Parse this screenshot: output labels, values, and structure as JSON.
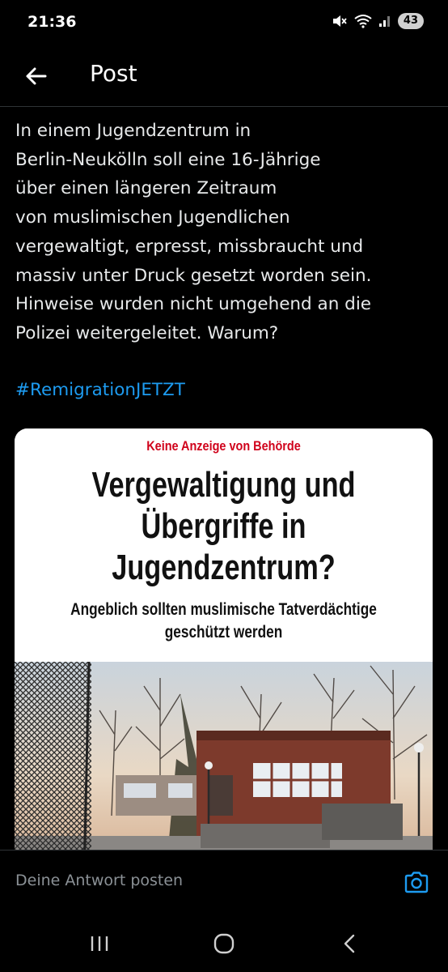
{
  "status_bar": {
    "time": "21:36",
    "battery": "43",
    "icons": [
      "mute-icon",
      "wifi-icon",
      "signal-icon"
    ]
  },
  "header": {
    "title": "Post",
    "back_icon": "arrow-left-icon"
  },
  "post": {
    "text": "In einem Jugendzentrum in\nBerlin-Neukölln soll eine 16-Jährige\nüber einen längeren Zeitraum\nvon muslimischen Jugendlichen\nvergewaltigt, erpresst, missbraucht und\nmassiv unter Druck gesetzt worden sein.\nHinweise wurden nicht umgehend an die\nPolizei weitergeleitet. Warum?",
    "hashtag": "#RemigrationJETZT"
  },
  "article": {
    "kicker": "Keine Anzeige von Behörde",
    "headline": "Vergewaltigung und\nÜbergriffe in\nJugendzentrum?",
    "subline": "Angeblich sollten muslimische Tatverdächtige\ngeschützt werden"
  },
  "reply": {
    "placeholder": "Deine Antwort posten",
    "camera_icon": "camera-icon"
  },
  "colors": {
    "accent": "#1d9bf0",
    "kicker_red": "#d0021b",
    "background": "#000000",
    "text": "#e7e9ea",
    "muted": "#8b9196"
  },
  "nav": {
    "icons": [
      "recent-apps-icon",
      "home-icon",
      "back-icon"
    ]
  }
}
